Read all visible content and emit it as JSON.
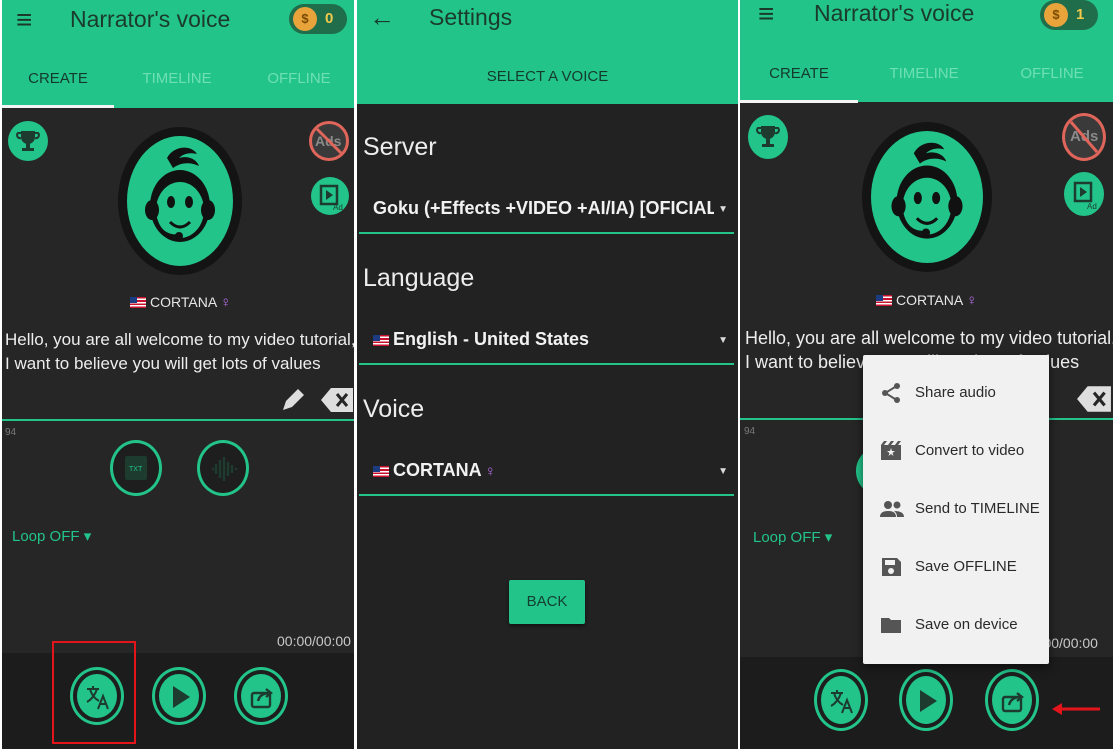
{
  "colors": {
    "accent": "#22c48a",
    "panel_bg": "#262626",
    "highlight": "#e4141b",
    "popup_bg": "#f1f1f1"
  },
  "screen1": {
    "title": "Narrator's voice",
    "coins": "0",
    "tabs": [
      "CREATE",
      "TIMELINE",
      "OFFLINE"
    ],
    "ads_label": "Ads",
    "voice": "CORTANA",
    "venus": "♀",
    "text_line1": "Hello, you are all welcome to my video tutorial,",
    "text_line2": "I want to believe you will get lots of values",
    "char_count": "94",
    "loop": "Loop OFF ▾",
    "time": "00:00/00:00",
    "icons": [
      "menu-icon",
      "money-bag-icon",
      "trophy-icon",
      "no-ads-icon",
      "video-ad-icon",
      "avatar-icon",
      "pencil-icon",
      "backspace-icon",
      "txt-file-icon",
      "waveform-icon",
      "translate-icon",
      "play-icon",
      "share-icon"
    ]
  },
  "screen2": {
    "title": "Settings",
    "subheader": "SELECT A VOICE",
    "server_label": "Server",
    "server_value": "Goku (+Effects +VIDEO +AI/IA) [OFICIAL]",
    "language_label": "Language",
    "language_value": "English - United States",
    "voice_label": "Voice",
    "voice_value": "CORTANA",
    "back": "BACK"
  },
  "screen3": {
    "title": "Narrator's voice",
    "coins": "1",
    "tabs": [
      "CREATE",
      "TIMELINE",
      "OFFLINE"
    ],
    "ads_label": "Ads",
    "voice": "CORTANA",
    "text_line1": "Hello, you are all welcome to my video tutorial,",
    "text_line2": "I want to believe you will get lots of values",
    "char_count": "94",
    "loop": "Loop OFF ▾",
    "time": "00:00/00:00",
    "menu": [
      "Share audio",
      "Convert to video",
      "Send to TIMELINE",
      "Save OFFLINE",
      "Save on device"
    ]
  }
}
